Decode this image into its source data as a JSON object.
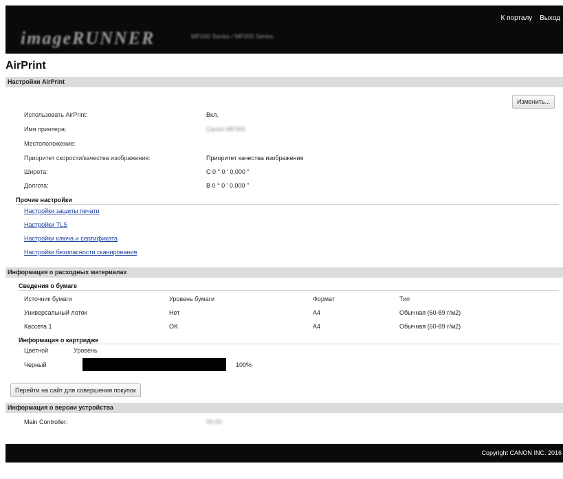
{
  "header": {
    "logo": "imageRUNNER",
    "model": "MF000 Series / MF000 Series",
    "link_portal": "К порталу",
    "link_logout": "Выход"
  },
  "page_title": "AirPrint",
  "airprint_section": {
    "title": "Настройки AirPrint",
    "edit_button": "Изменить...",
    "rows": [
      {
        "label": "Использовать AirPrint:",
        "value": "Вкл."
      },
      {
        "label": "Имя принтера:",
        "value": "Canon MF000"
      },
      {
        "label": "Местоположение:",
        "value": ""
      },
      {
        "label": "Приоритет скорости/качества изображения:",
        "value": "Приоритет качества изображения"
      },
      {
        "label": "Широта:",
        "value": "С 0 ° 0 ' 0.000 \""
      },
      {
        "label": "Долгота:",
        "value": "В 0 ° 0 ' 0.000 \""
      }
    ]
  },
  "other_settings": {
    "title": "Прочие настройки",
    "links": [
      "Настройки защиты печати",
      "Настройки TLS",
      "Настройки ключа и сертификата",
      "Настройки безопасности сканирования"
    ]
  },
  "consumables_section": {
    "title": "Информация о расходных материалах",
    "paper": {
      "title": "Сведения о бумаге",
      "headers": [
        "Источник бумаги",
        "Уровень бумаги",
        "Формат",
        "Тип"
      ],
      "rows": [
        [
          "Универсальный лоток",
          "Нет",
          "A4",
          "Обычная (60-89 г/м2)"
        ],
        [
          "Кассета 1",
          "OK",
          "A4",
          "Обычная (60-89 г/м2)"
        ]
      ]
    },
    "cartridge": {
      "title": "Информация о картридже",
      "headers": [
        "Цветной",
        "Уровень"
      ],
      "color": "Черный",
      "level": 100,
      "level_text": "100%"
    },
    "shop_button": "Перейти на сайт для совершения покупок"
  },
  "device_section": {
    "title": "Информация о версии устройства",
    "label": "Main Controller:",
    "value": "00.00"
  },
  "footer": {
    "copyright": "Copyright CANON INC. 2016"
  }
}
